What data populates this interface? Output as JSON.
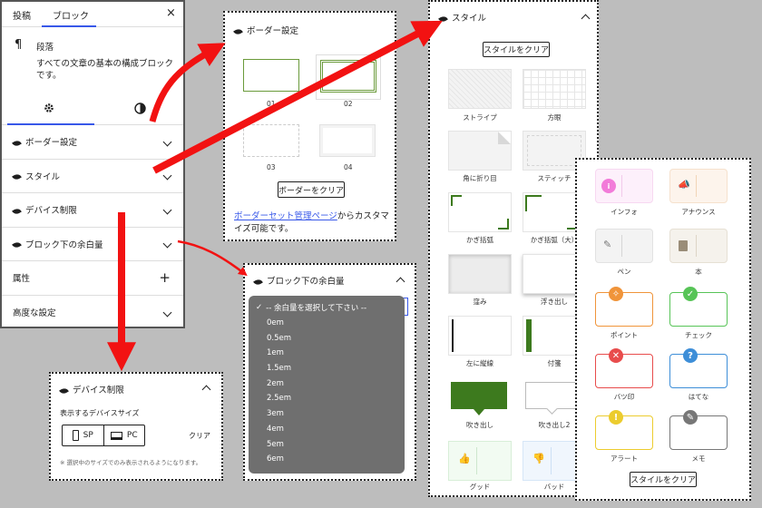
{
  "sidebar": {
    "tab_post": "投稿",
    "tab_block": "ブロック",
    "close": "×",
    "block_icon": "¶",
    "block_title": "段落",
    "block_desc": "すべての文章の基本の構成ブロックです。",
    "rows": [
      {
        "label": "ボーダー設定",
        "icon": "chevron-down"
      },
      {
        "label": "スタイル",
        "icon": "chevron-down"
      },
      {
        "label": "デバイス制限",
        "icon": "chevron-down"
      },
      {
        "label": "ブロック下の余白量",
        "icon": "chevron-down"
      },
      {
        "label": "属性",
        "icon": "plus"
      },
      {
        "label": "高度な設定",
        "icon": "chevron-down"
      }
    ],
    "plus": "+"
  },
  "border_panel": {
    "title": "ボーダー設定",
    "presets": [
      "01",
      "02",
      "03",
      "04"
    ],
    "clear": "ボーダーをクリア",
    "link": "ボーダーセット管理ページ",
    "after_link": "からカスタマイズ可能です。"
  },
  "style_panel": {
    "title": "スタイル",
    "clear": "スタイルをクリア",
    "styles": [
      "ストライプ",
      "方眼",
      "角に折り目",
      "スティッチ",
      "かぎ括弧",
      "かぎ括弧（大）",
      "窪み",
      "浮き出し",
      "左に縦線",
      "付箋",
      "吹き出し",
      "吹き出し2",
      "グッド",
      "バッド"
    ]
  },
  "callout_panel": {
    "clear": "スタイルをクリア",
    "items": [
      {
        "label": "インフォ",
        "color": "#f27bd9"
      },
      {
        "label": "アナウンス",
        "color": "#f0a64a"
      },
      {
        "label": "ペン",
        "color": "#999999"
      },
      {
        "label": "本",
        "color": "#9a8d78"
      },
      {
        "label": "ポイント",
        "color": "#f0943a"
      },
      {
        "label": "チェック",
        "color": "#57c457"
      },
      {
        "label": "バツ印",
        "color": "#e84c4c"
      },
      {
        "label": "はてな",
        "color": "#3d8ed8"
      },
      {
        "label": "アラート",
        "color": "#eccc2e"
      },
      {
        "label": "メモ",
        "color": "#777777"
      }
    ]
  },
  "margin_panel": {
    "title": "ブロック下の余白量",
    "options": [
      "-- 余白量を選択して下さい --",
      "0em",
      "0.5em",
      "1em",
      "1.5em",
      "2em",
      "2.5em",
      "3em",
      "4em",
      "5em",
      "6em"
    ],
    "check": "✓"
  },
  "device_panel": {
    "title": "デバイス制限",
    "subtitle": "表示するデバイスサイズ",
    "sp": "SP",
    "pc": "PC",
    "clear": "クリア",
    "note": "※ 選択中のサイズでのみ表示されるようになります。"
  },
  "colors": {
    "accent": "#3858e9",
    "arrow": "#f21212",
    "green": "#3d7a1e"
  }
}
